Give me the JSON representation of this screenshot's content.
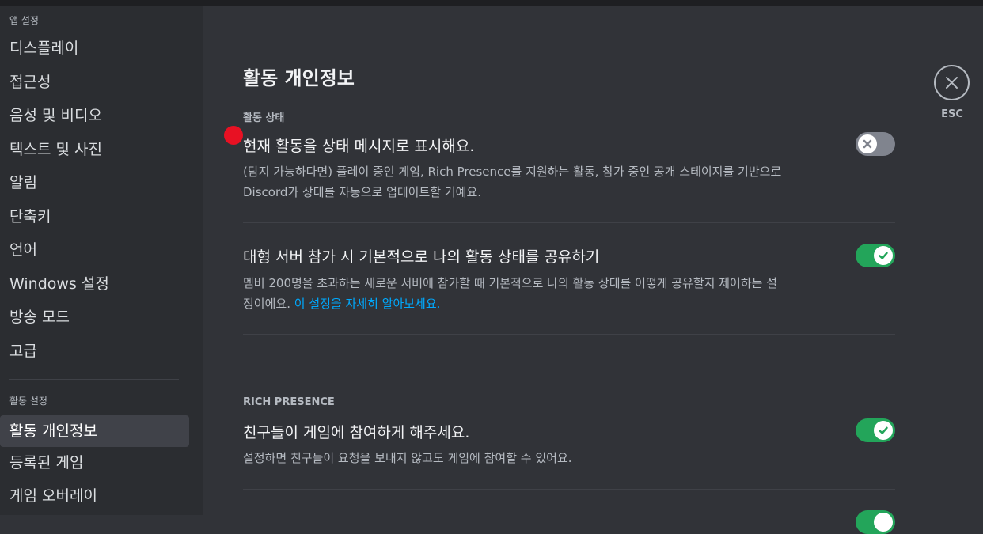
{
  "sidebar": {
    "app_settings_header": "앱 설정",
    "app_items": [
      {
        "label": "디스플레이"
      },
      {
        "label": "접근성"
      },
      {
        "label": "음성 및 비디오"
      },
      {
        "label": "텍스트 및 사진"
      },
      {
        "label": "알림"
      },
      {
        "label": "단축키"
      },
      {
        "label": "언어"
      },
      {
        "label": "Windows 설정"
      },
      {
        "label": "방송 모드"
      },
      {
        "label": "고급"
      }
    ],
    "activity_settings_header": "활동 설정",
    "activity_items": [
      {
        "label": "활동 개인정보",
        "active": true
      },
      {
        "label": "등록된 게임"
      },
      {
        "label": "게임 오버레이"
      }
    ]
  },
  "main": {
    "title": "활동 개인정보",
    "activity_status_label": "활동 상태",
    "options": [
      {
        "title": "현재 활동을 상태 메시지로 표시해요.",
        "desc_line1": "(탐지 가능하다면) 플레이 중인 게임, Rich Presence를 지원하는 활동, 참가 중인 공개 스테이지를 기반으로",
        "desc_line2": "Discord가 상태를 자동으로 업데이트할 거예요.",
        "enabled": false
      },
      {
        "title": "대형 서버 참가 시 기본적으로 나의 활동 상태를 공유하기",
        "desc_line1": "멤버 200명을 초과하는 새로운 서버에 참가할 때 기본적으로 나의 활동 상태를 어떻게 공유할지 제어하는 설",
        "desc_line2": "정이에요.",
        "link": "이 설정을 자세히 알아보세요.",
        "enabled": true
      }
    ],
    "rich_presence_label": "RICH PRESENCE",
    "rich_options": [
      {
        "title": "친구들이 게임에 참여하게 해주세요.",
        "desc": "설정하면 친구들이 요청을 보내지 않고도 게임에 참여할 수 있어요.",
        "enabled": true
      }
    ]
  },
  "close": {
    "label": "ESC",
    "icon": "close-icon"
  },
  "colors": {
    "toggle_on": "#23a55a",
    "toggle_off": "#80848e",
    "link": "#00a8fc",
    "cursor_dot": "#e81123"
  }
}
